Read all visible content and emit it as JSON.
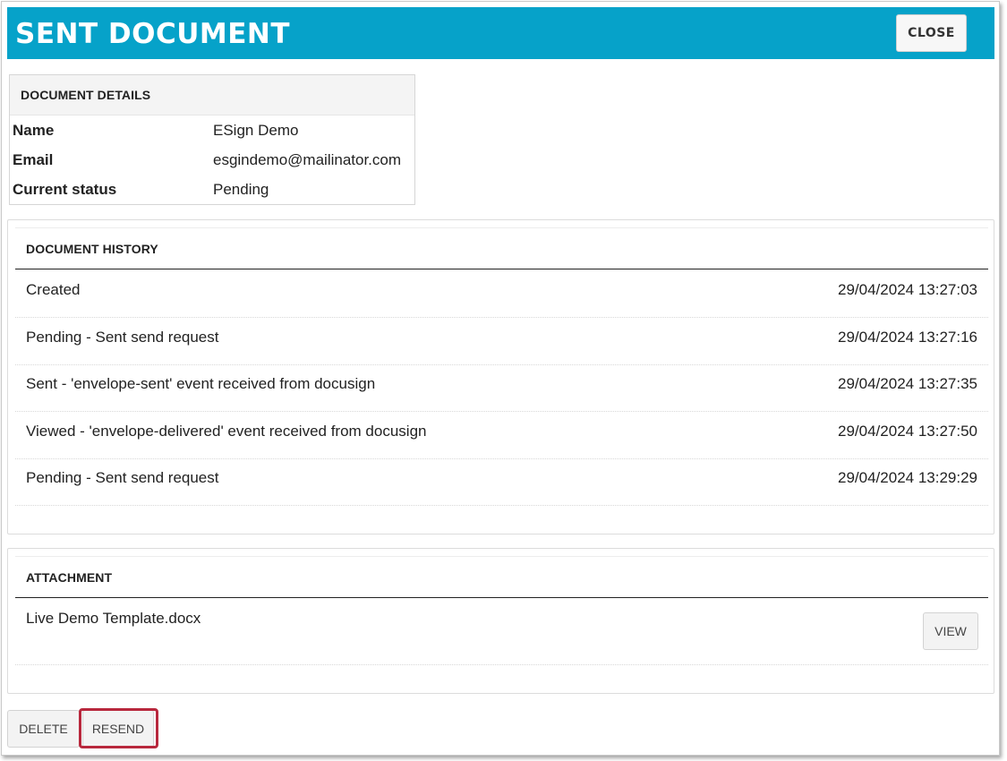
{
  "header": {
    "title": "SENT DOCUMENT",
    "close_label": "CLOSE",
    "bg_color": "#06a2c9"
  },
  "details": {
    "heading": "DOCUMENT DETAILS",
    "rows": [
      {
        "label": "Name",
        "value": "ESign Demo"
      },
      {
        "label": "Email",
        "value": "esgindemo@mailinator.com"
      },
      {
        "label": "Current status",
        "value": "Pending"
      }
    ]
  },
  "history": {
    "heading": "DOCUMENT HISTORY",
    "rows": [
      {
        "event": "Created",
        "time": "29/04/2024 13:27:03"
      },
      {
        "event": "Pending - Sent send request",
        "time": "29/04/2024 13:27:16"
      },
      {
        "event": "Sent - 'envelope-sent' event received from docusign",
        "time": "29/04/2024 13:27:35"
      },
      {
        "event": "Viewed - 'envelope-delivered' event received from docusign",
        "time": "29/04/2024 13:27:50"
      },
      {
        "event": "Pending - Sent send request",
        "time": "29/04/2024 13:29:29"
      }
    ]
  },
  "attachment": {
    "heading": "ATTACHMENT",
    "file_name": "Live Demo Template.docx",
    "view_label": "VIEW"
  },
  "actions": {
    "delete_label": "DELETE",
    "resend_label": "RESEND",
    "highlight_color": "#b8283d"
  }
}
